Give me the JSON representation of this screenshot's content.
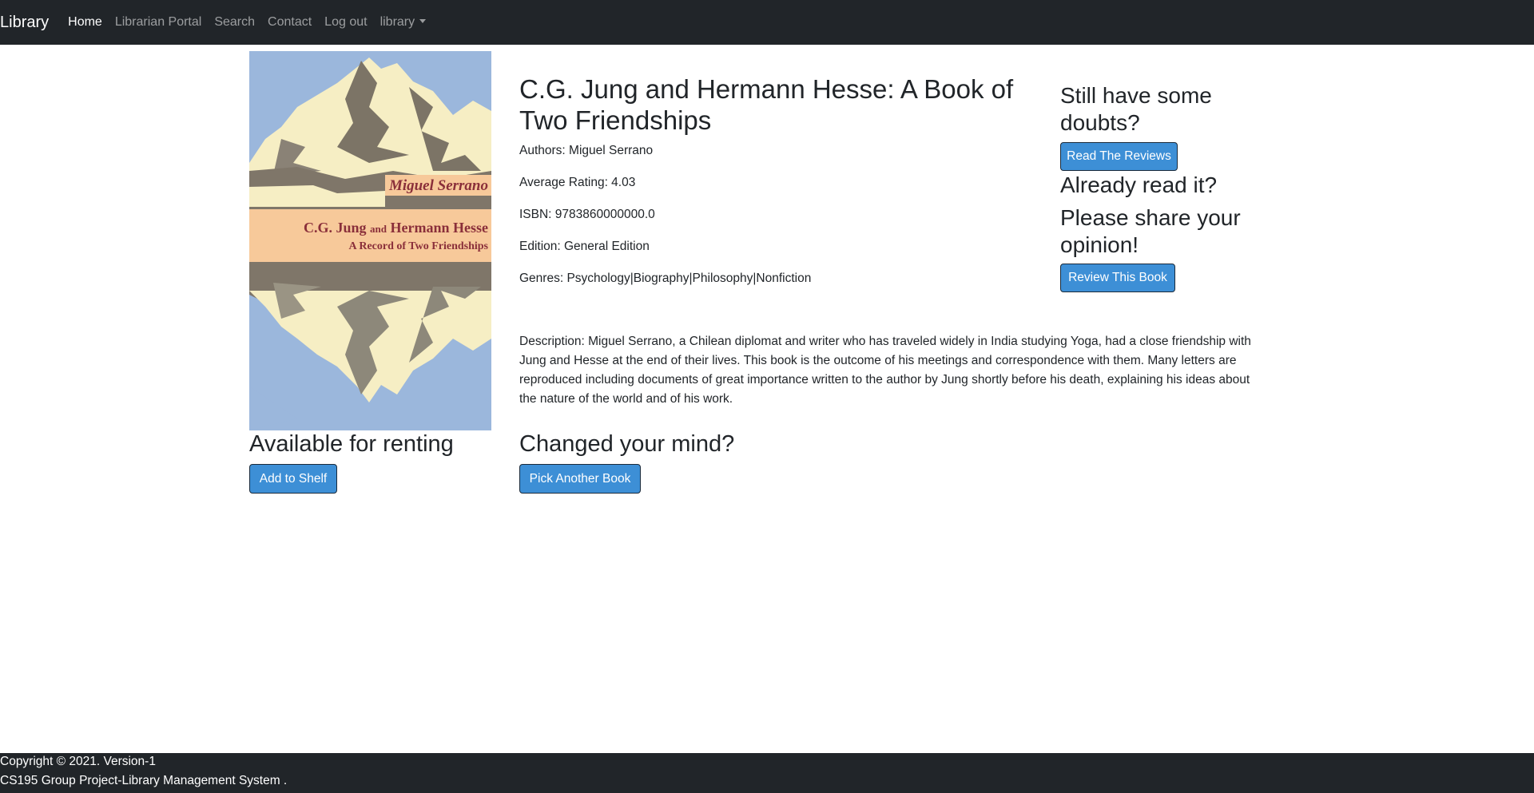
{
  "navbar": {
    "brand": "Library",
    "links": [
      {
        "label": "Home",
        "active": true
      },
      {
        "label": "Librarian Portal"
      },
      {
        "label": "Search"
      },
      {
        "label": "Contact"
      },
      {
        "label": "Log out"
      }
    ],
    "dropdown_label": "library"
  },
  "cover": {
    "author": "Miguel Serrano",
    "title_part1": "C.G. Jung",
    "title_and": "and",
    "title_part2": "Hermann Hesse",
    "subtitle": "A Record of Two Friendships"
  },
  "book": {
    "title": "C.G. Jung and Hermann Hesse: A Book of Two Friendships",
    "authors": "Authors: Miguel Serrano",
    "rating": "Average Rating: 4.03",
    "isbn": "ISBN: 9783860000000.0",
    "edition": "Edition: General Edition",
    "genres": "Genres: Psychology|Biography|Philosophy|Nonfiction",
    "description": "Description: Miguel Serrano, a Chilean diplomat and writer who has traveled widely in India studying Yoga, had a close friendship with Jung and Hesse at the end of their lives. This book is the outcome of his meetings and correspondence with them. Many letters are reproduced including documents of great importance written to the author by Jung shortly before his death, explaining his ideas about the nature of the world and of his work."
  },
  "side": {
    "doubts_heading": "Still have some doubts?",
    "read_reviews_button": "Read The Reviews",
    "already_read_heading": "Already read it?",
    "share_heading": "Please share your opinion!",
    "review_button": "Review This Book"
  },
  "bottom": {
    "available_heading": "Available for renting",
    "add_button": "Add to Shelf",
    "changed_heading": "Changed your mind?",
    "pick_button": "Pick Another Book"
  },
  "footer": {
    "copyright": "Copyright © 2021. Version-1",
    "project": "CS195 Group Project-Library Management System ."
  },
  "colors": {
    "navbar_bg": "#212529",
    "button_bg": "#3d8fd6",
    "cover_sky": "#9bb7dc",
    "cover_band": "#f7c99a",
    "cover_text": "#8a2f3a"
  }
}
